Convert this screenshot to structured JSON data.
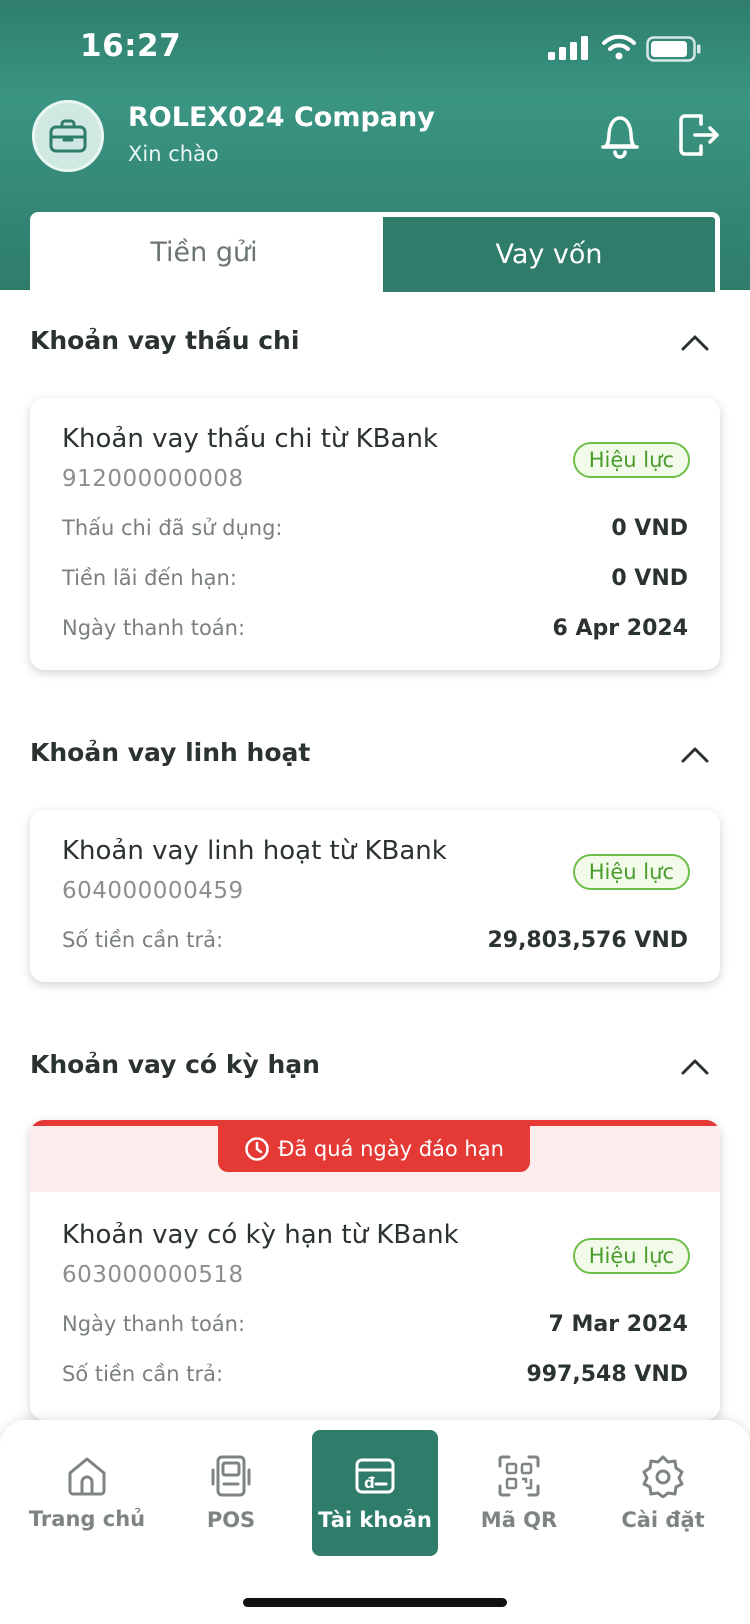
{
  "status_bar": {
    "time": "16:27"
  },
  "profile": {
    "company": "ROLEX024 Company",
    "greeting": "Xin chào"
  },
  "tabs": [
    {
      "label": "Tiền gửi"
    },
    {
      "label": "Vay vốn",
      "active": true
    }
  ],
  "sections": [
    {
      "title": "Khoản vay thấu chi",
      "card": {
        "title": "Khoản vay thấu chi từ KBank",
        "number": "912000000008",
        "badge": "Hiệu lực",
        "rows": [
          {
            "label": "Thấu chi đã sử dụng:",
            "value": "0 VND"
          },
          {
            "label": "Tiền lãi đến hạn:",
            "value": "0 VND"
          },
          {
            "label": "Ngày thanh toán:",
            "value": "6 Apr 2024"
          }
        ]
      }
    },
    {
      "title": "Khoản vay linh hoạt",
      "card": {
        "title": "Khoản vay linh hoạt từ KBank",
        "number": "604000000459",
        "badge": "Hiệu lực",
        "rows": [
          {
            "label": "Số tiền cần trả:",
            "value": "29,803,576 VND"
          }
        ]
      }
    },
    {
      "title": "Khoản vay có kỳ hạn",
      "card": {
        "alert": "Đã quá ngày đáo hạn",
        "title": "Khoản vay có kỳ hạn từ KBank",
        "number": "603000000518",
        "badge": "Hiệu lực",
        "rows": [
          {
            "label": "Ngày thanh toán:",
            "value": "7 Mar 2024"
          },
          {
            "label": "Số tiền cần trả:",
            "value": "997,548 VND"
          }
        ]
      }
    }
  ],
  "bottom_nav": [
    {
      "label": "Trang chủ",
      "icon": "home-icon"
    },
    {
      "label": "POS",
      "icon": "pos-icon"
    },
    {
      "label": "Tài khoản",
      "icon": "account-icon",
      "active": true
    },
    {
      "label": "Mã QR",
      "icon": "qr-icon"
    },
    {
      "label": "Cài đặt",
      "icon": "gear-icon"
    }
  ],
  "colors": {
    "brand": "#2f7c6b",
    "badge_green": "#4a9c2c",
    "alert_red": "#e53935"
  }
}
